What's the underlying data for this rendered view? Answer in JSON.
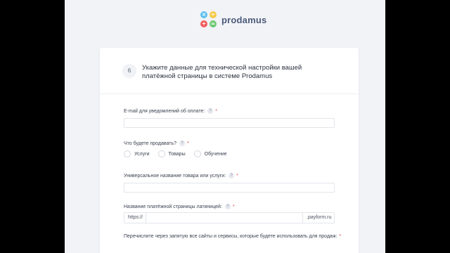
{
  "logo": {
    "text": "prodamus",
    "symbols": [
      "×",
      "÷",
      "+",
      "="
    ]
  },
  "step": {
    "number": "6",
    "title": "Укажите данные для технической настройки вашей платёжной страницы в системе Prodamus"
  },
  "fields": {
    "email": {
      "label": "E-mail для уведомлений об оплате:",
      "required_mark": "*",
      "value": ""
    },
    "sell": {
      "label": "Что будете продавать?",
      "required_mark": "*",
      "options": [
        "Услуги",
        "Товары",
        "Обучение"
      ]
    },
    "product_name": {
      "label": "Универсальное название товара или услуги:",
      "required_mark": "*",
      "value": ""
    },
    "page_name": {
      "label": "Название платёжной страницы латиницей:",
      "required_mark": "*",
      "prefix": "https://",
      "suffix": ".payform.ru",
      "value": ""
    },
    "sites": {
      "label": "Перечислите через запятую все сайты и сервисы, которые будете использовать для продаж:",
      "required_mark": "*"
    }
  },
  "help_icon_glyph": "?",
  "colors": {
    "background": "#f1f3f7",
    "card": "#ffffff",
    "required": "#e14b4b",
    "logo_text": "#4c5a7a"
  },
  "icons": [
    "logo-icon",
    "help-icon"
  ]
}
